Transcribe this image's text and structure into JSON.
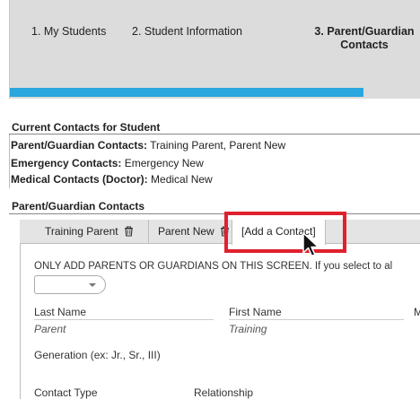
{
  "steps": [
    {
      "label": "1. My Students"
    },
    {
      "label": "2. Student Information"
    },
    {
      "label_line1": "3. Parent/Guardian",
      "label_line2": "Contacts"
    }
  ],
  "progress_fraction": 0.86,
  "summary": {
    "title": "Current Contacts for Student",
    "parent_label": "Parent/Guardian Contacts:",
    "parent_value": "Training Parent, Parent New",
    "emergency_label": "Emergency Contacts:",
    "emergency_value": "Emergency New",
    "medical_label": "Medical Contacts (Doctor):",
    "medical_value": "Medical New"
  },
  "section_title": "Parent/Guardian Contacts",
  "tabs": [
    {
      "label": "Training Parent",
      "icon": "trash-icon"
    },
    {
      "label": "Parent New",
      "icon": "trash-icon"
    },
    {
      "label": "[Add a Contact]"
    }
  ],
  "form": {
    "notice": "ONLY ADD PARENTS OR GUARDIANS ON THIS SCREEN. If you select to al",
    "last_name_label": "Last Name",
    "last_name_value": "Parent",
    "first_name_label": "First Name",
    "first_name_value": "Training",
    "middle_label_partial": "M",
    "generation_label": "Generation (ex: Jr., Sr., III)",
    "contact_type_label": "Contact Type",
    "relationship_label": "Relationship"
  },
  "colors": {
    "progress": "#2aa7de",
    "highlight": "#e0202d"
  }
}
